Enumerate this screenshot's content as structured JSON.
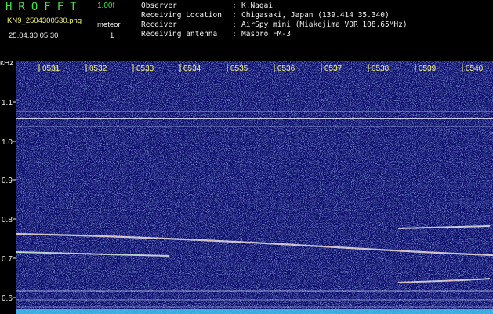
{
  "header": {
    "app_title": "HROFFT",
    "version": "1.00f",
    "filename": "KN9_2504300530.png",
    "datetime": "25.04.30 05:30",
    "meteor_label": "meteor",
    "meteor_count": "1",
    "info": [
      {
        "key": "Observer",
        "value": "K.Nagai"
      },
      {
        "key": "Receiving Location",
        "value": "Chigasaki, Japan (139.414 35.340)"
      },
      {
        "key": "Receiver",
        "value": "AirSpy mini (Miakejima VOR 108.65MHz)"
      },
      {
        "key": "Receiving antenna",
        "value": "Maspro FM-3"
      }
    ]
  },
  "spectrogram": {
    "y_unit": "kHz",
    "y_ticks": [
      "1.1",
      "1.0",
      "0.9",
      "0.8",
      "0.7",
      "0.6"
    ],
    "time_labels": [
      "0531",
      "0532",
      "0533",
      "0534",
      "0535",
      "0536",
      "0537",
      "0538",
      "0539",
      "0540"
    ],
    "colors": {
      "background": "#0a0f6e",
      "noise_light": "#5a72ff",
      "signal": "#f2f2f2",
      "axis_text": "#f2f2f2",
      "time_text": "#f5f57a"
    }
  }
}
